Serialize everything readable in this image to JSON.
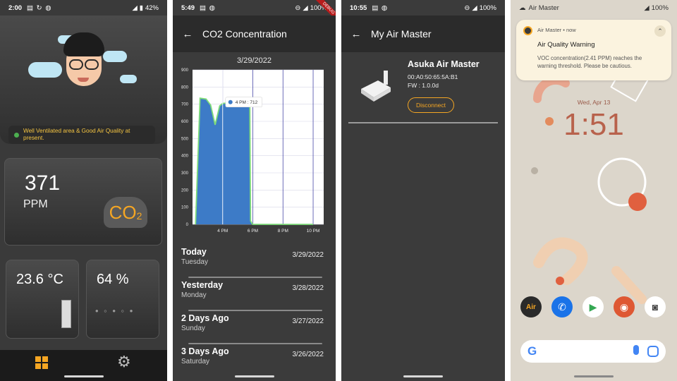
{
  "phone1": {
    "status": {
      "time": "2:00",
      "battery": "42%"
    },
    "ventilation_message": "Well Ventilated area & Good Air Quality at present.",
    "co2": {
      "value": "371",
      "unit": "PPM",
      "badge": "CO",
      "badge_sub": "2"
    },
    "temperature": "23.6 °C",
    "humidity": "64 %",
    "nav": {
      "dashboard_icon": "dashboard-icon",
      "settings_icon": "gear-icon"
    }
  },
  "phone2": {
    "status": {
      "time": "5:49",
      "battery": "100%"
    },
    "title": "CO2 Concentration",
    "debug_label": "DEBUG",
    "chart_date": "3/29/2022",
    "days": [
      {
        "name": "Today",
        "weekday": "Tuesday",
        "date": "3/29/2022"
      },
      {
        "name": "Yesterday",
        "weekday": "Monday",
        "date": "3/28/2022"
      },
      {
        "name": "2 Days Ago",
        "weekday": "Sunday",
        "date": "3/27/2022"
      },
      {
        "name": "3 Days Ago",
        "weekday": "Saturday",
        "date": "3/26/2022"
      }
    ]
  },
  "phone3": {
    "status": {
      "time": "10:55",
      "battery": "100%"
    },
    "title": "My Air Master",
    "device": {
      "name": "Asuka Air Master",
      "mac": "00:A0:50:65:5A:B1",
      "fw": "FW : 1.0.0d"
    },
    "disconnect_label": "Disconnect"
  },
  "phone4": {
    "status": {
      "app": "Air Master",
      "battery": "100%"
    },
    "notification": {
      "app": "Air Master • now",
      "title": "Air Quality Warning",
      "body": "VOC concentration(2.41 PPM) reaches the warning threshold. Please be cautious."
    },
    "home_date": "Wed, Apr 13",
    "home_clock": "1:51",
    "colors": {
      "accent": "#b8624c",
      "wallpaper": "#dcd6cb"
    }
  },
  "chart_data": {
    "type": "area",
    "title": "",
    "x_ticks": [
      "4 PM",
      "6 PM",
      "8 PM",
      "10 PM"
    ],
    "y_ticks": [
      0,
      100,
      200,
      300,
      400,
      500,
      600,
      700,
      800,
      900
    ],
    "ylim": [
      0,
      900
    ],
    "x_hours": [
      14.2,
      14.5,
      14.9,
      15.2,
      15.5,
      15.8,
      16.0,
      16.3,
      16.6,
      16.9,
      17.2,
      17.5,
      17.8,
      17.85,
      17.95,
      18.0,
      22.0
    ],
    "y_values": [
      0,
      735,
      730,
      695,
      580,
      690,
      705,
      706,
      712,
      708,
      710,
      705,
      695,
      20,
      5,
      0,
      0
    ],
    "tooltip": "4 PM : 712",
    "colors": {
      "fill": "#3d7bc7",
      "line": "#7fdc7a",
      "grid": "#4a4aa8"
    }
  }
}
